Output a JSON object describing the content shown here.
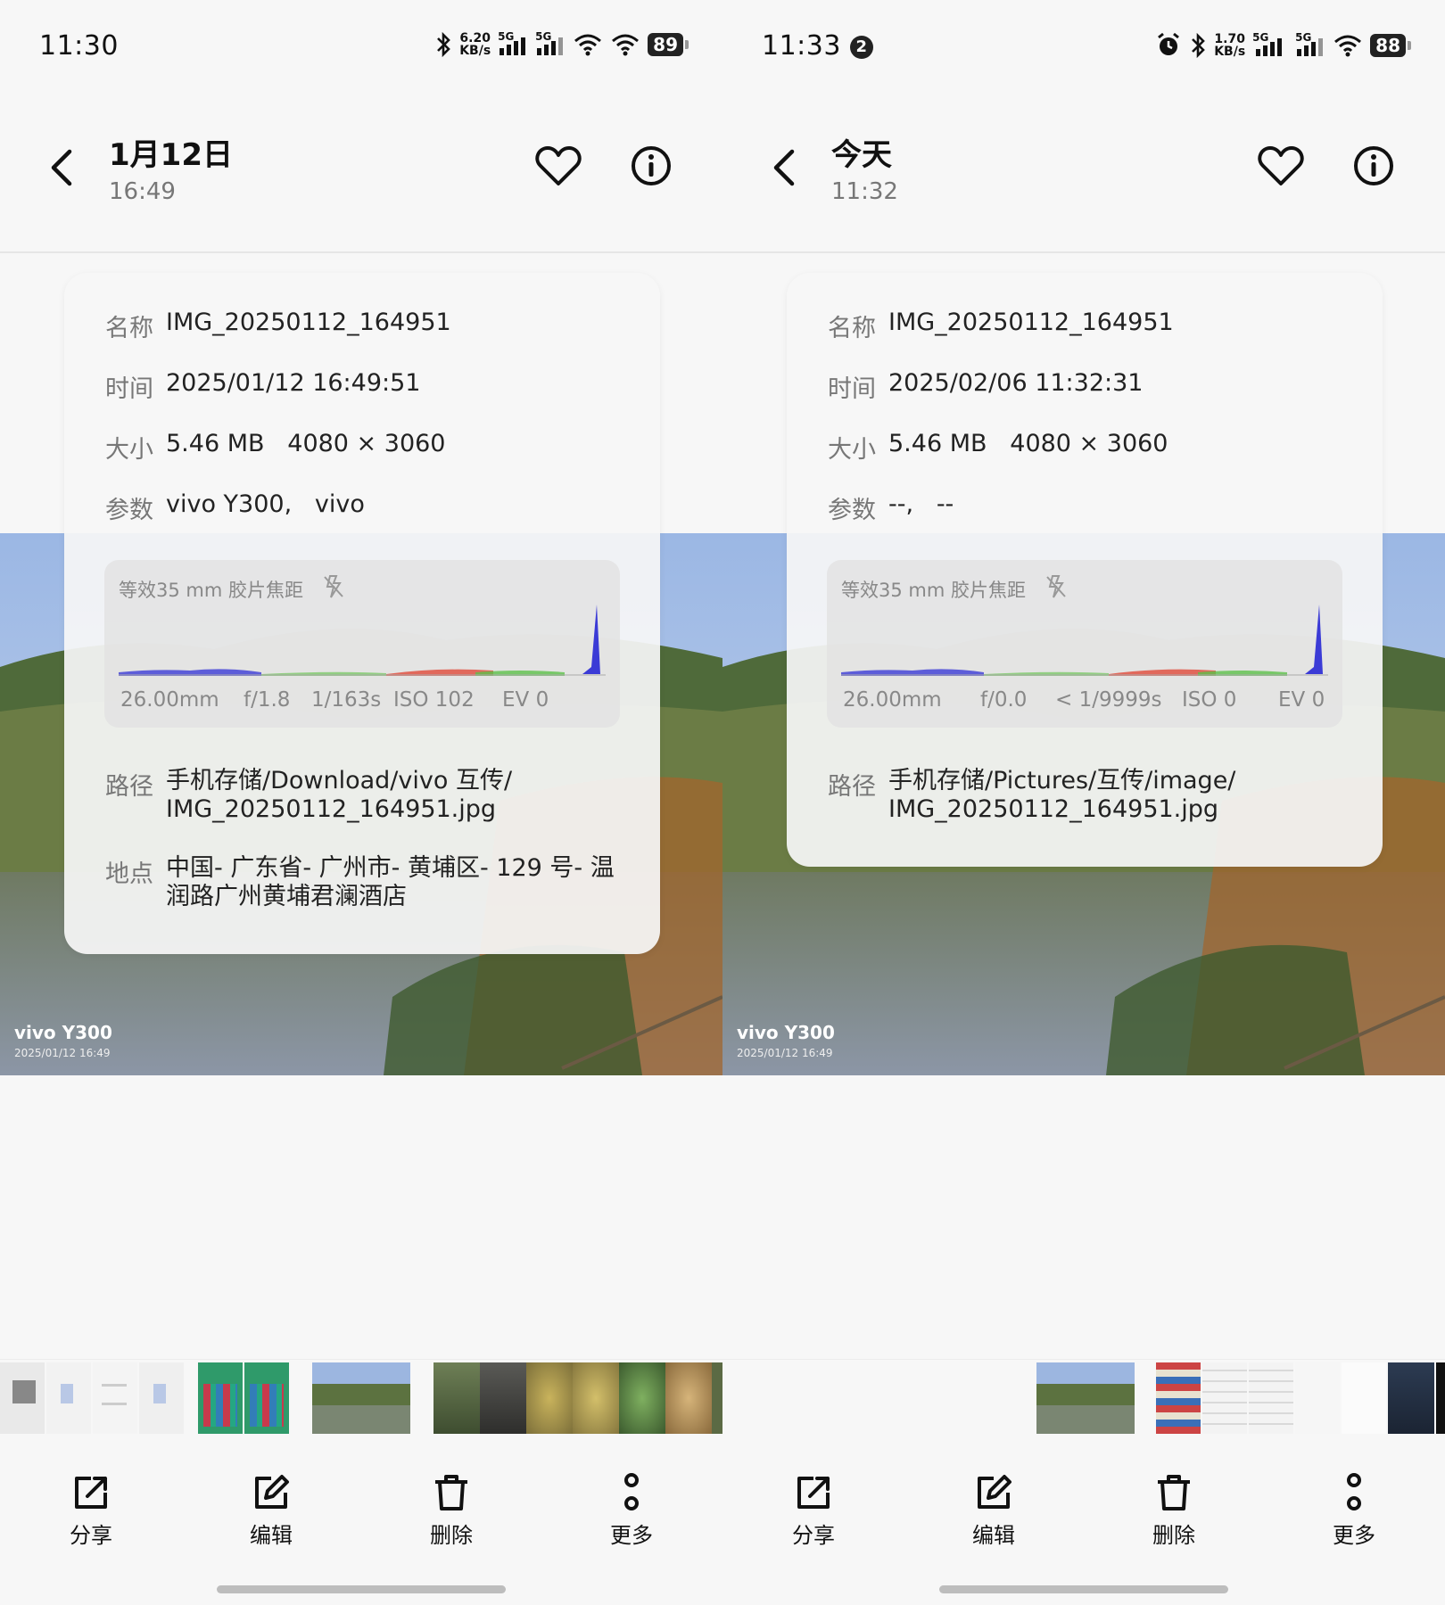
{
  "panels": [
    {
      "status": {
        "time": "11:30",
        "badge": "",
        "net_speed": "6.20",
        "net_unit": "KB/s",
        "signal_1": "5G",
        "signal_2": "5G",
        "battery": "89"
      },
      "header": {
        "title": "1月12日",
        "subtitle": "16:49"
      },
      "info": {
        "name_label": "名称",
        "name": "IMG_20250112_164951",
        "time_label": "时间",
        "time": "2025/01/12 16:49:51",
        "size_label": "大小",
        "size": "5.46 MB   4080 × 3060",
        "params_label": "参数",
        "params": "vivo Y300,   vivo",
        "exif": {
          "label": "等效35 mm 胶片焦距",
          "focal": "26.00mm",
          "aperture": "f/1.8",
          "shutter": "1/163s",
          "iso": "ISO 102",
          "ev": "EV 0"
        },
        "path_label": "路径",
        "path": "手机存储/Download/vivo 互传/\nIMG_20250112_164951.jpg",
        "location_label": "地点",
        "location": "中国- 广东省- 广州市- 黄埔区- 129 号- 温\n润路广州黄埔君澜酒店"
      },
      "photo": {
        "watermark_model": "vivo Y300",
        "watermark_time": "2025/01/12 16:49"
      },
      "actions": {
        "share": "分享",
        "edit": "编辑",
        "delete": "删除",
        "more": "更多"
      }
    },
    {
      "status": {
        "time": "11:33",
        "badge": "2",
        "net_speed": "1.70",
        "net_unit": "KB/s",
        "signal_1": "5G",
        "signal_2": "5G",
        "battery": "88"
      },
      "header": {
        "title": "今天",
        "subtitle": "11:32"
      },
      "info": {
        "name_label": "名称",
        "name": "IMG_20250112_164951",
        "time_label": "时间",
        "time": "2025/02/06 11:32:31",
        "size_label": "大小",
        "size": "5.46 MB   4080 × 3060",
        "params_label": "参数",
        "params": "--,   --",
        "exif": {
          "label": "等效35 mm 胶片焦距",
          "focal": "26.00mm",
          "aperture": "f/0.0",
          "shutter": "< 1/9999s",
          "iso": "ISO 0",
          "ev": "EV 0"
        },
        "path_label": "路径",
        "path": "手机存储/Pictures/互传/image/\nIMG_20250112_164951.jpg"
      },
      "photo": {
        "watermark_model": "vivo Y300",
        "watermark_time": "2025/01/12 16:49"
      },
      "actions": {
        "share": "分享",
        "edit": "编辑",
        "delete": "删除",
        "more": "更多"
      }
    }
  ],
  "colors": {
    "background": "#f7f7f7",
    "card": "#f6f6f6",
    "label_gray": "#777777",
    "histogram_blue": "#3b3bd6",
    "histogram_red": "#e04a3a",
    "histogram_green": "#5cc04a"
  }
}
